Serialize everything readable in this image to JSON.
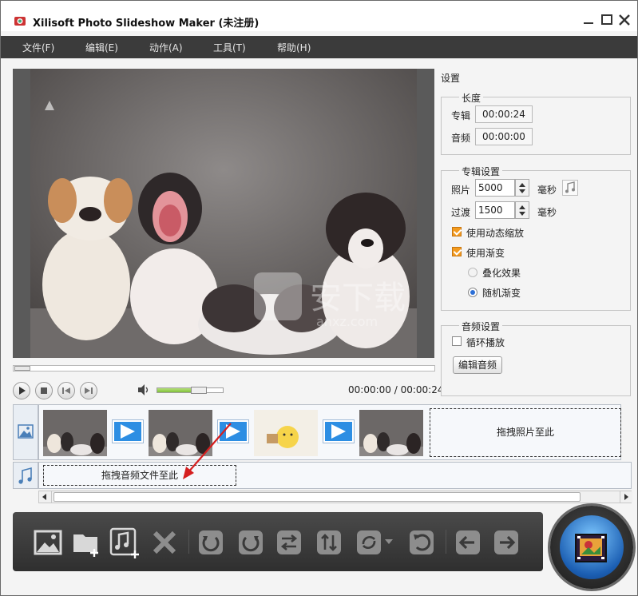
{
  "window": {
    "title": "Xilisoft Photo Slideshow Maker (未注册)"
  },
  "menu": [
    "文件(F)",
    "编辑(E)",
    "动作(A)",
    "工具(T)",
    "帮助(H)"
  ],
  "player": {
    "time_display": "00:00:00 / 00:00:24",
    "seek_progress": 0,
    "volume_level": 0.75
  },
  "preview": {
    "watermark_text": "安下载",
    "watermark_domain": "anxz.com"
  },
  "settings": {
    "title": "设置",
    "duration": {
      "label": "长度",
      "album_label": "专辑",
      "album_value": "00:00:24",
      "audio_label": "音频",
      "audio_value": "00:00:00"
    },
    "album": {
      "label": "专辑设置",
      "photo_label": "照片",
      "photo_value": "5000",
      "photo_unit": "毫秒",
      "transition_label": "过渡",
      "transition_value": "1500",
      "transition_unit": "毫秒",
      "dynamic_zoom_label": "使用动态缩放",
      "dynamic_zoom_checked": true,
      "fade_label": "使用渐变",
      "fade_checked": true,
      "overlay_label": "叠化效果",
      "random_label": "随机渐变",
      "random_selected": true
    },
    "audio": {
      "label": "音频设置",
      "loop_label": "循环播放",
      "loop_checked": false,
      "edit_button": "编辑音频"
    }
  },
  "timeline": {
    "photo_drop_text": "拖拽照片至此",
    "audio_drop_text": "拖拽音频文件至此"
  },
  "toolbar": [
    "add-photo",
    "add-folder",
    "add-music",
    "delete",
    "rotate-left",
    "rotate-right",
    "swap",
    "sort",
    "refresh",
    "undo",
    "move-left",
    "move-right"
  ]
}
